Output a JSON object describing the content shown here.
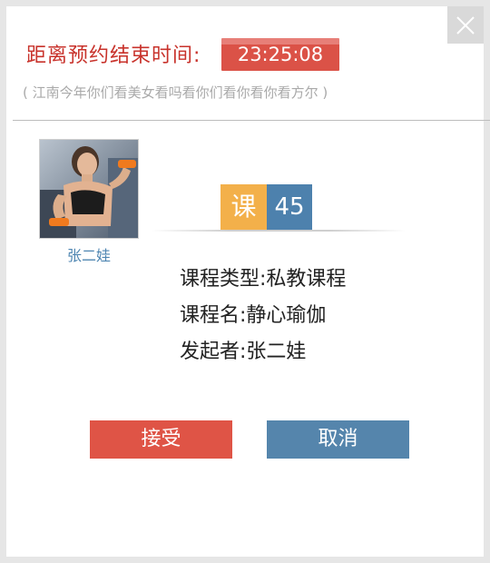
{
  "dialog": {
    "countdown_label": "距离预约结束时间:",
    "countdown_value": "23:25:08",
    "subtitle": "( 江南今年你们看美女看吗看你们看你看你看方尔 )"
  },
  "profile": {
    "name": "张二娃"
  },
  "badge": {
    "course_label": "课",
    "course_count": "45"
  },
  "info": {
    "type_label": "课程类型:",
    "type_value": "私教课程",
    "name_label": "课程名:",
    "name_value": "静心瑜伽",
    "initiator_label": "发起者:",
    "initiator_value": "张二娃"
  },
  "actions": {
    "accept_label": "接受",
    "cancel_label": "取消"
  },
  "colors": {
    "accent_red": "#df5446",
    "accent_blue": "#5585ac",
    "badge_orange": "#f3b04a"
  }
}
